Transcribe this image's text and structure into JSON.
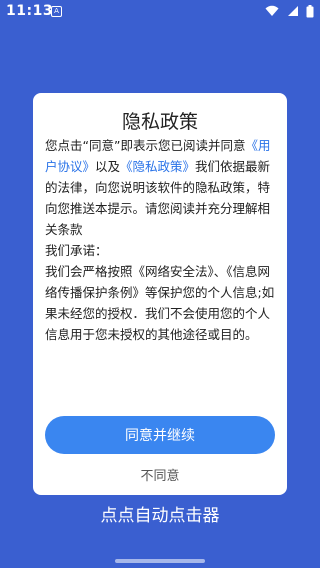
{
  "status_bar": {
    "time": "11:13",
    "notification_glyph": "A",
    "icons": [
      "wifi-icon",
      "signal-icon",
      "battery-icon"
    ]
  },
  "dialog": {
    "title": "隐私政策",
    "body": {
      "intro": "您点击“同意”即表示您已阅读并同意",
      "link_user_agreement": "《用户协议》",
      "and": "以及",
      "link_privacy_policy": "《隐私政策》",
      "paragraph1": "我们依据最新的法律，向您说明该软件的隐私政策，特向您推送本提示。请您阅读并充分理解相关条款",
      "commitment": "我们承诺：",
      "paragraph2": "我们会严格按照《网络安全法》、《信息网络传播保护条例》等保护您的个人信息;如果未经您的授权．我们不会使用您的个人信息用于您未授权的其他途径或目的。"
    },
    "agree_button": "同意并继续",
    "disagree_link": "不同意"
  },
  "app_name": "点点自动点击器",
  "colors": {
    "background": "#3a5fd0",
    "button": "#3a86f0",
    "link": "#2a73e8"
  }
}
